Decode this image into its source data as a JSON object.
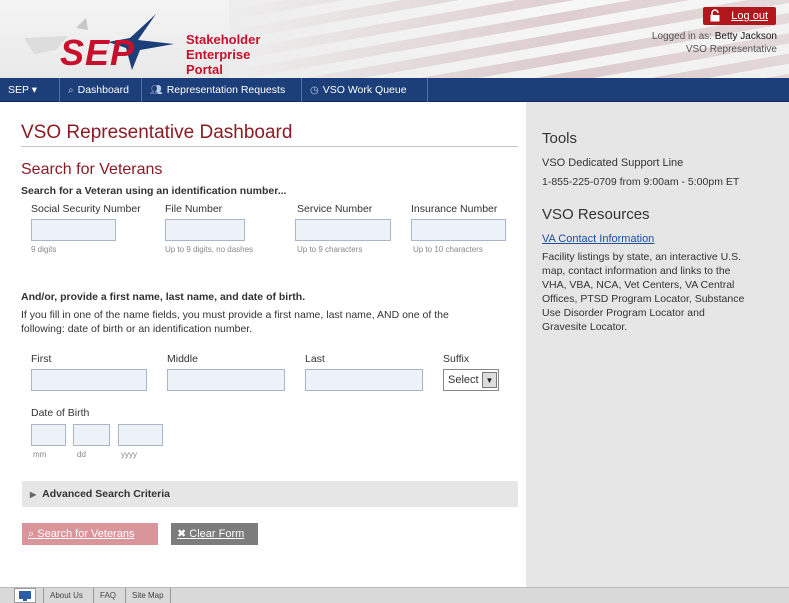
{
  "header": {
    "logo_text": "SEP",
    "portal_title_line1": "Stakeholder",
    "portal_title_line2": "Enterprise Portal",
    "logout_label": "Log out",
    "logged_in_prefix": "Logged in as:",
    "user_name": "Betty Jackson",
    "user_role": "VSO Representative"
  },
  "nav": {
    "items": [
      {
        "label": "SEP ▾",
        "icon": ""
      },
      {
        "label": "Dashboard",
        "icon": "search-icon"
      },
      {
        "label": "Representation Requests",
        "icon": "people-icon"
      },
      {
        "label": "VSO Work Queue",
        "icon": "clock-icon"
      }
    ]
  },
  "main": {
    "page_title": "VSO Representative Dashboard",
    "search_title": "Search for Veterans",
    "id_subhead": "Search for a Veteran using an identification number...",
    "id_fields": [
      {
        "label": "Social Security Number",
        "hint": "9 digits",
        "value": ""
      },
      {
        "label": "File Number",
        "hint": "Up to 9 digits, no dashes",
        "value": ""
      },
      {
        "label": "Service Number",
        "hint": "Up to 9 characters",
        "value": ""
      },
      {
        "label": "Insurance Number",
        "hint": "Up to 10 characters",
        "value": ""
      }
    ],
    "name_subhead": "And/or, provide a first name, last name, and date of birth.",
    "name_help_line1": "If you fill in one of the name fields, you must provide a first name, last name, AND one of the",
    "name_help_line2": "following: date of birth or an identification number.",
    "name_fields": [
      {
        "label": "First",
        "value": ""
      },
      {
        "label": "Middle",
        "value": ""
      },
      {
        "label": "Last",
        "value": ""
      }
    ],
    "suffix_label": "Suffix",
    "suffix_selected": "Select",
    "dob_label": "Date of Birth",
    "dob_hints": [
      "mm",
      "dd",
      "yyyy"
    ],
    "advanced_label": "Advanced Search Criteria",
    "search_button": "Search for Veterans",
    "clear_button": "Clear Form"
  },
  "sidebar": {
    "tools_title": "Tools",
    "support_line_label": "VSO Dedicated Support Line",
    "support_line_detail": "1-855-225-0709 from 9:00am - 5:00pm ET",
    "resources_title": "VSO Resources",
    "va_link": "VA Contact Information",
    "va_desc_lines": [
      "Facility listings by state, an interactive U.S.",
      "map, contact information and links to the",
      "VHA, VBA, NCA, Vet Centers, VA Central",
      "Offices, PTSD Program Locator, Substance",
      "Use Disorder Program Locator and",
      "Gravesite Locator."
    ]
  },
  "footer": {
    "items": [
      "About Us",
      "FAQ",
      "Site Map"
    ]
  },
  "colors": {
    "brand_red": "#8b1c24",
    "nav_blue": "#1c3f7a",
    "logout_red": "#b3161c"
  }
}
